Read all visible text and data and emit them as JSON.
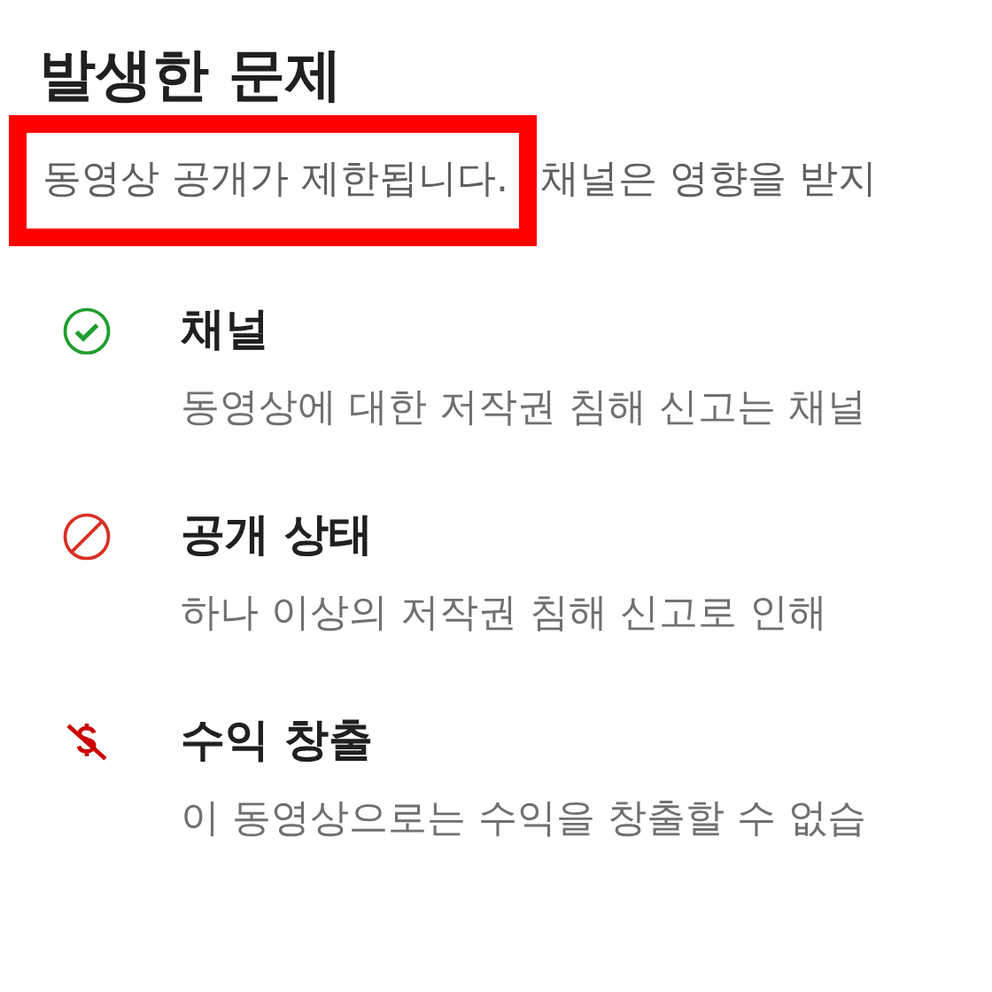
{
  "title": "발생한 문제",
  "summary": [
    {
      "text": "동영상 공개가 제한됩니다.",
      "highlighted": true
    },
    {
      "text": "채널은 영향을 받지",
      "highlighted": false
    }
  ],
  "items": [
    {
      "kind": "ok",
      "heading": "채널",
      "description": "동영상에 대한 저작권 침해 신고는 채널"
    },
    {
      "kind": "blocked",
      "heading": "공개 상태",
      "description": "하나 이상의 저작권 침해 신고로 인해"
    },
    {
      "kind": "no-money",
      "heading": "수익 창출",
      "description": "이 동영상으로는 수익을 창출할 수 없습"
    }
  ]
}
